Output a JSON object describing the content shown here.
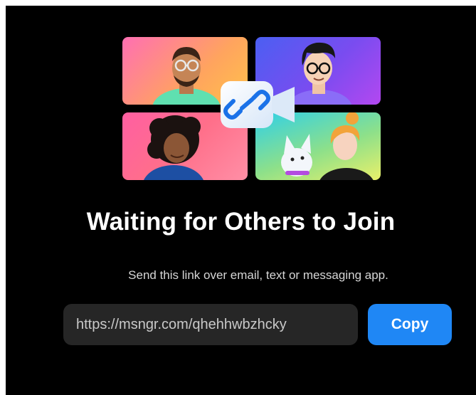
{
  "dialog": {
    "title": "Waiting for Others to Join",
    "subtitle": "Send this link over email, text or messaging app.",
    "link": "https://msngr.com/qhehhwbzhcky",
    "copy_label": "Copy"
  },
  "illustration": {
    "center_icon": "video-link-icon",
    "tiles": [
      "person-with-glasses",
      "person-with-glasses-curly",
      "person-curly-hair",
      "person-with-dog"
    ]
  },
  "colors": {
    "background": "#000000",
    "accent": "#1f87f5",
    "field_bg": "#262626"
  }
}
